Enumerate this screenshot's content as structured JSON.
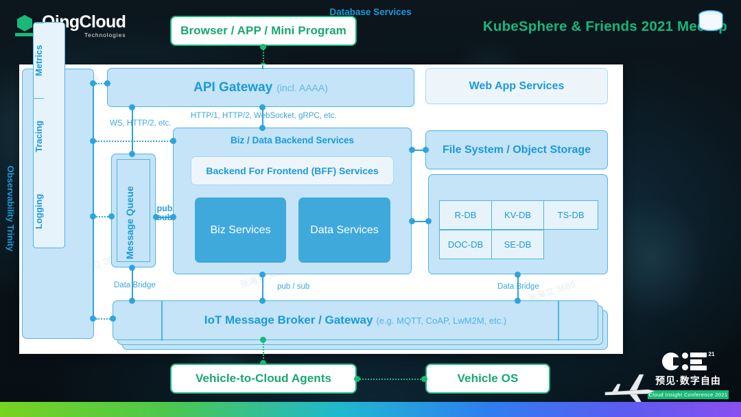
{
  "header": {
    "logo_name": "QingCloud",
    "logo_sub": "Technologies",
    "logo_mark_icon": "qingcloud-hexagon-icon",
    "meetup_title": "KubeSphere & Friends 2021 Meetup"
  },
  "colors": {
    "brand_green": "#19b978",
    "accent_blue": "#3fa9dc",
    "box_fill": "#c5e4f7",
    "box_border": "#4db4e4",
    "pale_fill": "#e6f3fb",
    "text_blue": "#1a9ad9",
    "panel_bg": "#ffffff",
    "page_bg": "#0a1118"
  },
  "endpoints": {
    "browser": "Browser / APP / Mini Program",
    "vehicle_agents": "Vehicle-to-Cloud Agents",
    "vehicle_os": "Vehicle OS"
  },
  "observability": {
    "title": "Observability Trinity",
    "cells": [
      "Metrics",
      "Tracing",
      "Logging"
    ]
  },
  "message_queue": {
    "title": "Message Queue"
  },
  "api_gateway": {
    "title": "API Gateway",
    "subtitle": "(incl. AAAA)",
    "db_icon": "database-cylinder-icon"
  },
  "web_app": {
    "title": "Web App Services"
  },
  "backend": {
    "title": "Biz / Data Backend Services",
    "bff": "Backend For Frontend (BFF) Services",
    "biz_services": "Biz Services",
    "data_services": "Data Services"
  },
  "storage": {
    "file_system": "File System / Object Storage"
  },
  "database": {
    "title": "Database Services",
    "cells": [
      "R-DB",
      "KV-DB",
      "TS-DB",
      "DOC-DB",
      "SE-DB"
    ]
  },
  "iot": {
    "title": "IoT Message Broker / Gateway",
    "subtitle": "(e.g. MQTT, CoAP, LwM2M, etc.)"
  },
  "connectors": {
    "ws_http2": "WS, HTTP/2, etc.",
    "http_protocols": "HTTP/1, HTTP/2, WebSocket, gRPC, etc.",
    "pub": "pub",
    "sub": "sub",
    "pub_sub": "pub / sub",
    "data_bridge_left": "Data Bridge",
    "data_bridge_right": "Data Bridge"
  },
  "watermark": {
    "text": "张海立 3686"
  },
  "cic": {
    "cn": "预见·数字自由",
    "en": "Cloud Insight Conference 2021",
    "sup": "21"
  }
}
